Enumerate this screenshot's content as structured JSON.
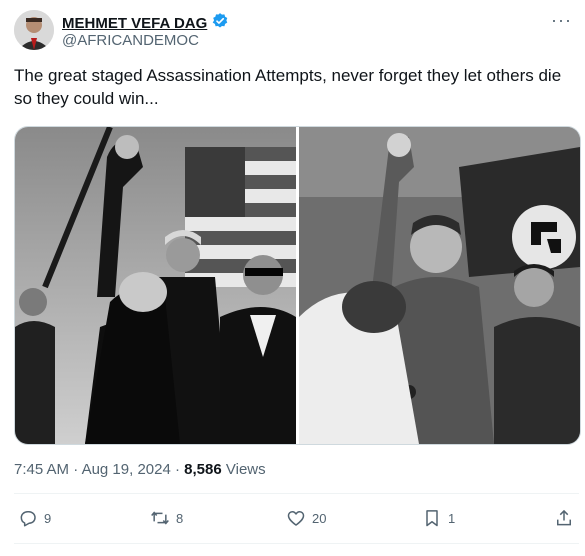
{
  "author": {
    "display_name": "MEHMET VEFA DAG",
    "handle": "@AFRICANDEMOC",
    "verified": true
  },
  "tweet": {
    "text": "The great staged Assassination Attempts, never forget they let others die so they could win..."
  },
  "media": {
    "images": [
      {
        "icon": "photo-rally-raised-fist"
      },
      {
        "icon": "photo-historical-raised-fist"
      }
    ]
  },
  "meta": {
    "time": "7:45 AM",
    "date": "Aug 19, 2024",
    "views_count": "8,586",
    "views_label": "Views"
  },
  "actions": {
    "replies": "9",
    "reposts": "8",
    "likes": "20",
    "bookmarks": "1"
  },
  "colors": {
    "verified": "#1d9bf0",
    "secondary_text": "#536471",
    "primary_text": "#0f1419"
  }
}
